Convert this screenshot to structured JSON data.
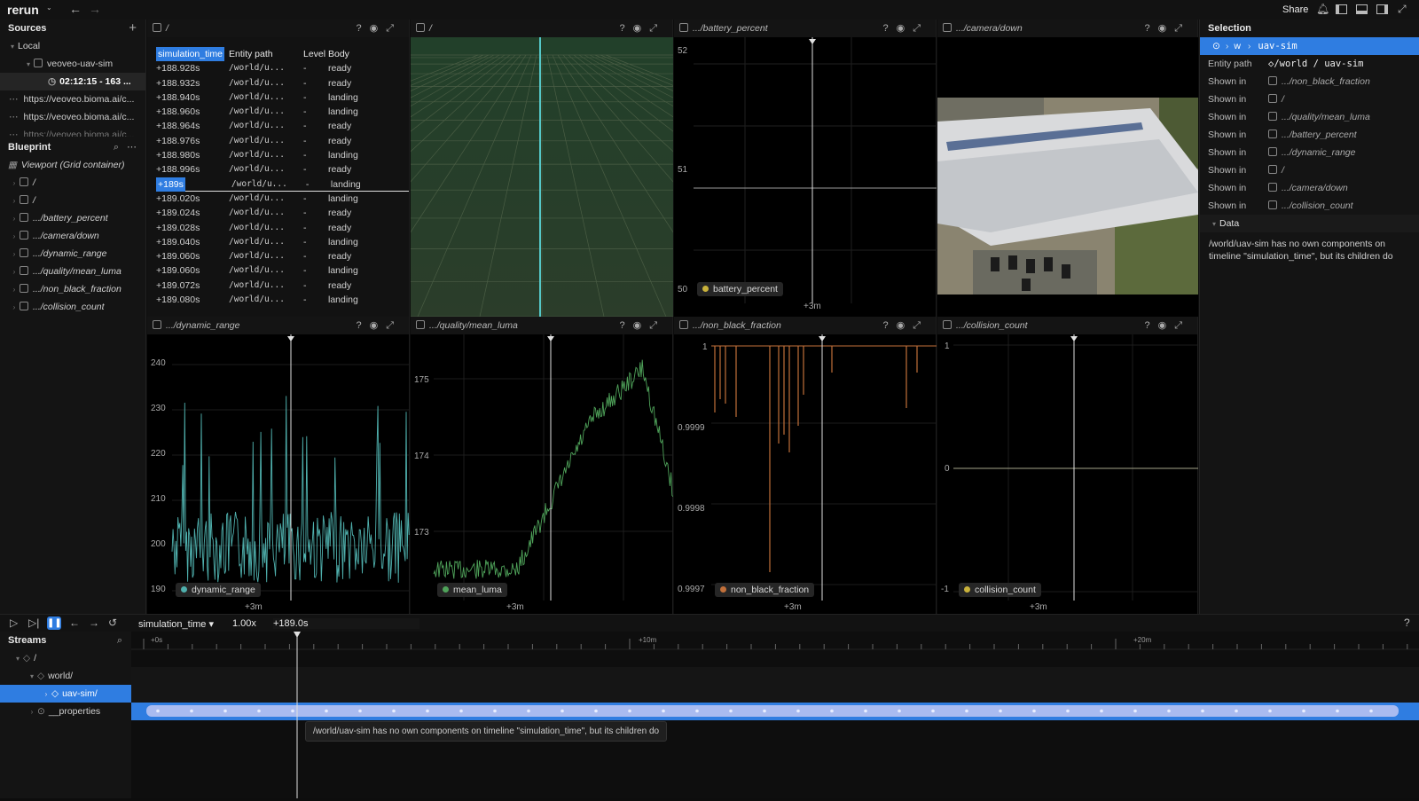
{
  "app": {
    "logo": "rerun",
    "share": "Share"
  },
  "sources": {
    "title": "Sources",
    "local": "Local",
    "recording": "veoveo-uav-sim",
    "session": "02:12:15 - 163 ...",
    "urls": [
      "https://veoveo.bioma.ai/c...",
      "https://veoveo.bioma.ai/c...",
      "https://veoveo.bioma.ai/c..."
    ]
  },
  "blueprint": {
    "title": "Blueprint",
    "viewport": "Viewport (Grid container)",
    "items": [
      "/",
      "/",
      ".../battery_percent",
      ".../camera/down",
      ".../dynamic_range",
      ".../quality/mean_luma",
      ".../non_black_fraction",
      ".../collision_count"
    ]
  },
  "views": {
    "table": {
      "title": "/",
      "headers": [
        "simulation_time",
        "Entity path",
        "Level",
        "Body"
      ],
      "rows": [
        [
          "+188.928s",
          "/world/u...",
          "-",
          "ready"
        ],
        [
          "+188.932s",
          "/world/u...",
          "-",
          "ready"
        ],
        [
          "+188.940s",
          "/world/u...",
          "-",
          "landing"
        ],
        [
          "+188.960s",
          "/world/u...",
          "-",
          "landing"
        ],
        [
          "+188.964s",
          "/world/u...",
          "-",
          "ready"
        ],
        [
          "+188.976s",
          "/world/u...",
          "-",
          "ready"
        ],
        [
          "+188.980s",
          "/world/u...",
          "-",
          "landing"
        ],
        [
          "+188.996s",
          "/world/u...",
          "-",
          "ready"
        ],
        [
          "+189s",
          "/world/u...",
          "-",
          "landing"
        ],
        [
          "+189.020s",
          "/world/u...",
          "-",
          "landing"
        ],
        [
          "+189.024s",
          "/world/u...",
          "-",
          "ready"
        ],
        [
          "+189.028s",
          "/world/u...",
          "-",
          "ready"
        ],
        [
          "+189.040s",
          "/world/u...",
          "-",
          "landing"
        ],
        [
          "+189.060s",
          "/world/u...",
          "-",
          "ready"
        ],
        [
          "+189.060s",
          "/world/u...",
          "-",
          "landing"
        ],
        [
          "+189.072s",
          "/world/u...",
          "-",
          "ready"
        ],
        [
          "+189.080s",
          "/world/u...",
          "-",
          "landing"
        ]
      ]
    },
    "spatial": {
      "title": "/"
    },
    "battery": {
      "title": ".../battery_percent",
      "y_ticks": [
        "52",
        "51",
        "50"
      ],
      "legend": "battery_percent",
      "x_tick": "+3m"
    },
    "camera": {
      "title": ".../camera/down"
    },
    "dynamic": {
      "title": ".../dynamic_range",
      "y_ticks": [
        "240",
        "230",
        "220",
        "210",
        "200",
        "190"
      ],
      "legend": "dynamic_range",
      "x_tick": "+3m"
    },
    "luma": {
      "title": ".../quality/mean_luma",
      "y_ticks": [
        "175",
        "174",
        "173"
      ],
      "legend": "mean_luma",
      "x_tick": "+3m"
    },
    "nbf": {
      "title": ".../non_black_fraction",
      "y_ticks": [
        "1",
        "0.9999",
        "0.9998",
        "0.9997"
      ],
      "legend": "non_black_fraction",
      "x_tick": "+3m"
    },
    "collision": {
      "title": ".../collision_count",
      "y_ticks": [
        "1",
        "0",
        "-1"
      ],
      "legend": "collision_count",
      "x_tick": "+3m"
    }
  },
  "selection": {
    "title": "Selection",
    "crumb_w": "w",
    "crumb_item": "uav-sim",
    "entity_label": "Entity path",
    "entity_value": "/world / uav-sim",
    "shown_label": "Shown in",
    "shown": [
      ".../non_black_fraction",
      "/",
      ".../quality/mean_luma",
      ".../battery_percent",
      ".../dynamic_range",
      "/",
      ".../camera/down",
      ".../collision_count"
    ],
    "data_title": "Data",
    "data_text": "/world/uav-sim has no own components on timeline \"simulation_time\", but its children do"
  },
  "timebar": {
    "timeline": "simulation_time",
    "speed": "1.00x",
    "time": "+189.0s"
  },
  "streams": {
    "title": "Streams",
    "root": "/",
    "world": "world/",
    "uav": "uav-sim/",
    "props": "__properties"
  },
  "timeline": {
    "marks": [
      "+0s",
      "+10m",
      "+20m"
    ],
    "tooltip": "/world/uav-sim has no own components on timeline \"simulation_time\", but its children do"
  },
  "colors": {
    "accent": "#2f7de1",
    "teal": "#4fb0ad",
    "green": "#4fa35a",
    "orange": "#c2703a"
  }
}
